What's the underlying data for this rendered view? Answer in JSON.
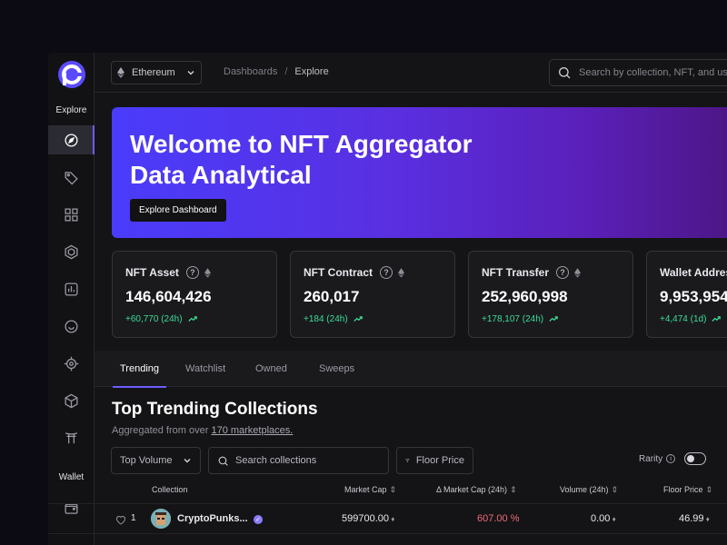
{
  "sidebar": {
    "explore_label": "Explore",
    "wallet_label": "Wallet",
    "items": [
      {
        "icon": "compass-icon"
      },
      {
        "icon": "tag-icon"
      },
      {
        "icon": "grid-icon"
      },
      {
        "icon": "hexagon-icon"
      },
      {
        "icon": "chart-icon"
      },
      {
        "icon": "smile-icon"
      },
      {
        "icon": "target-icon"
      },
      {
        "icon": "cube-icon"
      },
      {
        "icon": "gate-icon"
      },
      {
        "icon": "wallet-icon"
      }
    ]
  },
  "topbar": {
    "chain": "Ethereum",
    "breadcrumb": [
      "Dashboards",
      "Explore"
    ],
    "search_placeholder": "Search by collection, NFT, and user"
  },
  "hero": {
    "title_line1": "Welcome to NFT Aggregator",
    "title_line2": "Data Analytical",
    "button": "Explore Dashboard"
  },
  "stats": [
    {
      "label": "NFT Asset",
      "value": "146,604,426",
      "change": "+60,770 (24h)"
    },
    {
      "label": "NFT Contract",
      "value": "260,017",
      "change": "+184 (24h)"
    },
    {
      "label": "NFT Transfer",
      "value": "252,960,998",
      "change": "+178,107 (24h)"
    },
    {
      "label": "Wallet Address",
      "value": "9,953,954",
      "change": "+4,474 (1d)"
    }
  ],
  "tabs": [
    "Trending",
    "Watchlist",
    "Owned",
    "Sweeps"
  ],
  "collections": {
    "title": "Top Trending Collections",
    "subtitle_prefix": "Aggregated from over ",
    "subtitle_link": "170 marketplaces.",
    "filter_volume": "Top Volume",
    "search_placeholder": "Search collections",
    "filter_floor": "Floor Price",
    "rarity_label": "Rarity",
    "columns": [
      "Collection",
      "Market Cap",
      "Δ Market Cap (24h)",
      "Volume (24h)",
      "Floor Price"
    ],
    "rows": [
      {
        "rank": "1",
        "name": "CryptoPunks...",
        "market_cap": "599700.00",
        "delta": "607.00 %",
        "volume": "0.00",
        "floor": "46.99"
      }
    ]
  },
  "colors": {
    "accent": "#6b5cff",
    "positive": "#3ddc97",
    "negative": "#f06a7a"
  }
}
